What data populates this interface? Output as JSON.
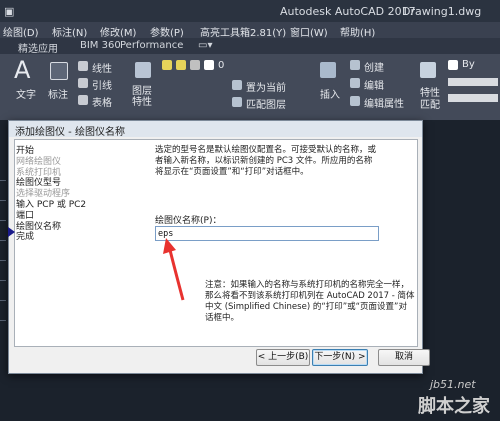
{
  "app": {
    "title": "Autodesk AutoCAD 2017",
    "drawing_name": "Drawing1.dwg"
  },
  "menubar": {
    "items": [
      "绘图(D)",
      "标注(N)",
      "修改(M)",
      "参数(P)",
      "高亮工具箱2.81(Y)",
      "窗口(W)",
      "帮助(H)"
    ]
  },
  "tabs": {
    "items": [
      "精选应用",
      "BIM 360",
      "Performance"
    ]
  },
  "ribbon": {
    "text_label": "文字",
    "dim_label": "标注",
    "linear_label": "线性",
    "leader_label": "引线",
    "table_label": "表格",
    "layer_props_label": "图层\n特性",
    "layer_value": "0",
    "set_current_label": "置为当前",
    "match_layer_label": "匹配图层",
    "insert_label": "插入",
    "create_label": "创建",
    "edit_label": "编辑",
    "edit_attr_label": "编辑属性",
    "props_label": "特性",
    "match_label": "匹配",
    "bylayer_label": "By"
  },
  "dialog": {
    "title": "添加绘图仪 - 绘图仪名称",
    "steps": [
      {
        "label": "开始",
        "dim": false
      },
      {
        "label": "网络绘图仪",
        "dim": true
      },
      {
        "label": "系统打印机",
        "dim": true
      },
      {
        "label": "绘图仪型号",
        "dim": false
      },
      {
        "label": "选择驱动程序",
        "dim": true
      },
      {
        "label": "输入 PCP 或 PC2",
        "dim": false
      },
      {
        "label": "端口",
        "dim": false
      },
      {
        "label": "绘图仪名称",
        "dim": false
      },
      {
        "label": "完成",
        "dim": false
      }
    ],
    "description": "选定的型号名是默认绘图仪配置名。可接受默认的名称，或者输入新名称，以标识新创建的 PC3 文件。所应用的名称将显示在“页面设置”和“打印”对话框中。",
    "name_label": "绘图仪名称(P)：",
    "name_value": "eps",
    "note": "注意：如果输入的名称与系统打印机的名称完全一样，那么将看不到该系统打印机列在 AutoCAD 2017 - 简体中文 (Simplified Chinese) 的“打印”或“页面设置”对话框中。",
    "buttons": {
      "back": "< 上一步(B)",
      "next": "下一步(N) >",
      "cancel": "取消"
    }
  },
  "watermark": {
    "site": "jb51.net",
    "name": "脚本之家"
  },
  "colors": {
    "annotation_arrow": "#e8322f",
    "step_pointer": "#1a1a8a"
  }
}
